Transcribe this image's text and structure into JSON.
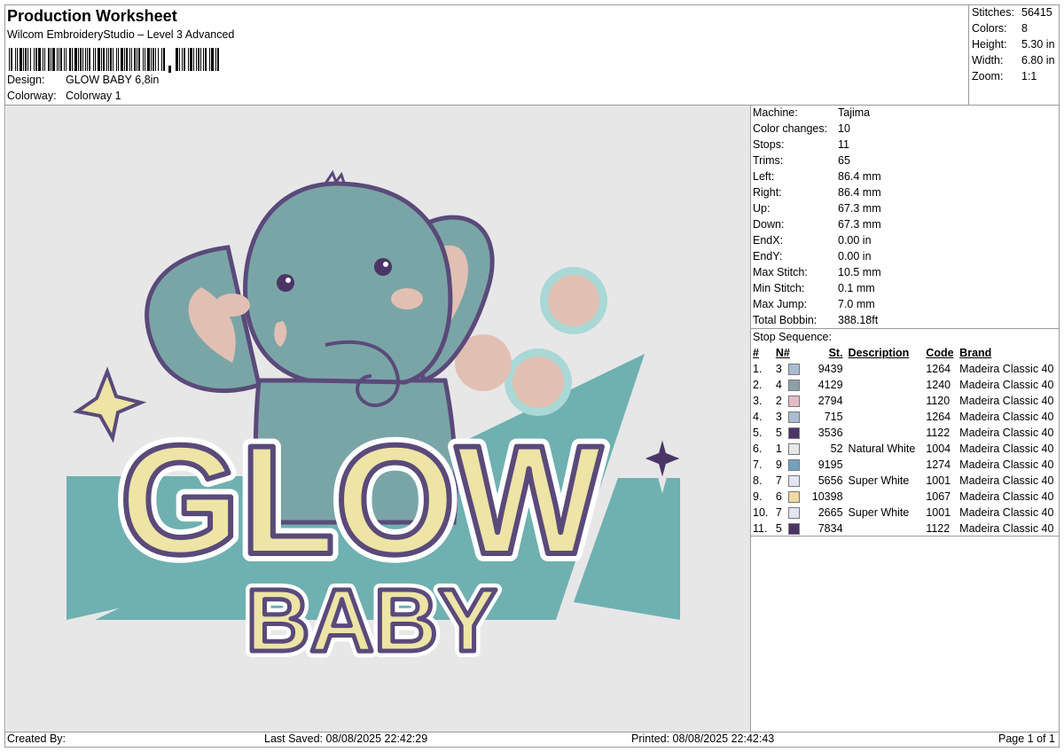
{
  "header": {
    "title": "Production Worksheet",
    "subtitle": "Wilcom EmbroideryStudio – Level 3 Advanced",
    "design_label": "Design:",
    "design_value": "GLOW BABY 6,8in",
    "colorway_label": "Colorway:",
    "colorway_value": "Colorway 1"
  },
  "summary": [
    {
      "label": "Stitches:",
      "value": "56415"
    },
    {
      "label": "Colors:",
      "value": "8"
    },
    {
      "label": "Height:",
      "value": "5.30 in"
    },
    {
      "label": "Width:",
      "value": "6.80 in"
    },
    {
      "label": "Zoom:",
      "value": "1:1"
    }
  ],
  "machine_info": [
    {
      "label": "Machine:",
      "value": "Tajima"
    },
    {
      "label": "Color changes:",
      "value": "10"
    },
    {
      "label": "Stops:",
      "value": "11"
    },
    {
      "label": "Trims:",
      "value": "65"
    },
    {
      "label": "Left:",
      "value": "86.4 mm"
    },
    {
      "label": "Right:",
      "value": "86.4 mm"
    },
    {
      "label": "Up:",
      "value": "67.3 mm"
    },
    {
      "label": "Down:",
      "value": "67.3 mm"
    },
    {
      "label": "EndX:",
      "value": "0.00 in"
    },
    {
      "label": "EndY:",
      "value": "0.00 in"
    },
    {
      "label": "Max Stitch:",
      "value": "10.5 mm"
    },
    {
      "label": "Min Stitch:",
      "value": "0.1 mm"
    },
    {
      "label": "Max Jump:",
      "value": "7.0 mm"
    },
    {
      "label": "Total Bobbin:",
      "value": "388.18ft"
    }
  ],
  "stop_sequence": {
    "title": "Stop Sequence:",
    "columns": [
      "#",
      "N#",
      "St.",
      "Description",
      "Code",
      "Brand"
    ],
    "rows": [
      {
        "idx": "1.",
        "n": "3",
        "color": "#a9bcd4",
        "st": "9439",
        "desc": "",
        "code": "1264",
        "brand": "Madeira Classic 40"
      },
      {
        "idx": "2.",
        "n": "4",
        "color": "#8da0a8",
        "st": "4129",
        "desc": "",
        "code": "1240",
        "brand": "Madeira Classic 40"
      },
      {
        "idx": "3.",
        "n": "2",
        "color": "#e5bcc5",
        "st": "2794",
        "desc": "",
        "code": "1120",
        "brand": "Madeira Classic 40"
      },
      {
        "idx": "4.",
        "n": "3",
        "color": "#a9bcd4",
        "st": "715",
        "desc": "",
        "code": "1264",
        "brand": "Madeira Classic 40"
      },
      {
        "idx": "5.",
        "n": "5",
        "color": "#4b3566",
        "st": "3536",
        "desc": "",
        "code": "1122",
        "brand": "Madeira Classic 40"
      },
      {
        "idx": "6.",
        "n": "1",
        "color": "#e8e8e8",
        "st": "52",
        "desc": "Natural White",
        "code": "1004",
        "brand": "Madeira Classic 40"
      },
      {
        "idx": "7.",
        "n": "9",
        "color": "#6fa3bf",
        "st": "9195",
        "desc": "",
        "code": "1274",
        "brand": "Madeira Classic 40"
      },
      {
        "idx": "8.",
        "n": "7",
        "color": "#e2e6f4",
        "st": "5656",
        "desc": "Super White",
        "code": "1001",
        "brand": "Madeira Classic 40"
      },
      {
        "idx": "9.",
        "n": "6",
        "color": "#f1d9a3",
        "st": "10398",
        "desc": "",
        "code": "1067",
        "brand": "Madeira Classic 40"
      },
      {
        "idx": "10.",
        "n": "7",
        "color": "#e2e6f4",
        "st": "2665",
        "desc": "Super White",
        "code": "1001",
        "brand": "Madeira Classic 40"
      },
      {
        "idx": "11.",
        "n": "5",
        "color": "#4b3566",
        "st": "7834",
        "desc": "",
        "code": "1122",
        "brand": "Madeira Classic 40"
      }
    ]
  },
  "design_art": {
    "word1": "GLOW",
    "word2": "BABY",
    "colors": {
      "background": "#e7e7e8",
      "teal": "#6fb0b0",
      "elephant": "#7aa5a6",
      "outline": "#5a4a7a",
      "letters": "#ede4a6",
      "pink": "#e1c0b3",
      "ring": "#a9d8d6"
    }
  },
  "footer": {
    "created_by": "Created By:",
    "last_saved": "Last Saved: 08/08/2025 22:42:29",
    "printed": "Printed: 08/08/2025 22:42:43",
    "page": "Page 1 of 1"
  }
}
